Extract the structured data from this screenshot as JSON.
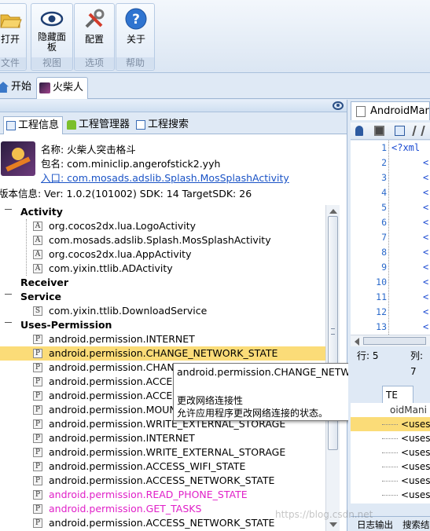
{
  "ribbon": {
    "groups": [
      {
        "button": "打开",
        "caption": "文件"
      },
      {
        "button": "隐藏面板",
        "caption": "视图"
      },
      {
        "button": "配置",
        "caption": "选项"
      },
      {
        "button": "关于",
        "caption": "帮助"
      }
    ]
  },
  "doc_tabs": [
    {
      "label": "开始",
      "active": false
    },
    {
      "label": "火柴人",
      "active": true
    }
  ],
  "sub_tabs": [
    "工程信息",
    "工程管理器",
    "工程搜索"
  ],
  "app_info": {
    "name": "名称: 火柴人突击格斗",
    "package": "包名: com.miniclip.angerofstick2.yyh",
    "entry": "入口: com.mosads.adslib.Splash.MosSplashActivity",
    "version": "版本信息:  Ver: 1.0.2(101002)  SDK: 14  TargetSDK: 26"
  },
  "tree": {
    "activity_label": "Activity",
    "activities": [
      "org.cocos2dx.lua.LogoActivity",
      "com.mosads.adslib.Splash.MosSplashActivity",
      "org.cocos2dx.lua.AppActivity",
      "com.yixin.ttlib.ADActivity"
    ],
    "receiver_label": "Receiver",
    "service_label": "Service",
    "services": [
      "com.yixin.ttlib.DownloadService"
    ],
    "permission_label": "Uses-Permission",
    "permissions": [
      "android.permission.INTERNET",
      "android.permission.CHANGE_NETWORK_STATE",
      "android.permission.CHANG",
      "android.permission.ACCESS",
      "android.permission.ACCESS",
      "android.permission.MOUNT",
      "android.permission.WRITE_EXTERNAL_STORAGE",
      "android.permission.INTERNET",
      "android.permission.WRITE_EXTERNAL_STORAGE",
      "android.permission.ACCESS_WIFI_STATE",
      "android.permission.ACCESS_NETWORK_STATE",
      "android.permission.READ_PHONE_STATE",
      "android.permission.GET_TASKS",
      "android.permission.ACCESS_NETWORK_STATE"
    ]
  },
  "tooltip": {
    "title": "android.permission.CHANGE_NETWORK_STATE",
    "name": "更改网络连接性",
    "desc": "允许应用程序更改网络连接的状态。"
  },
  "editor": {
    "file_tab": "AndroidMani",
    "first_line": "<?xml",
    "line_numbers": [
      "1",
      "2",
      "3",
      "4",
      "5",
      "6",
      "7",
      "8",
      "9",
      "10",
      "11",
      "12",
      "13"
    ],
    "line_prefix": "<",
    "status_row": "行: 5",
    "status_col": "列: 7"
  },
  "bottom_panel": {
    "tab": "TE",
    "header": "oidMani",
    "rows": [
      "<uses-",
      "<uses-",
      "<uses-",
      "<uses-",
      "<uses-",
      "<uses-"
    ],
    "footer_left": "日志输出",
    "footer_right": "搜索结"
  },
  "watermark": "https://blog.csdn.net"
}
